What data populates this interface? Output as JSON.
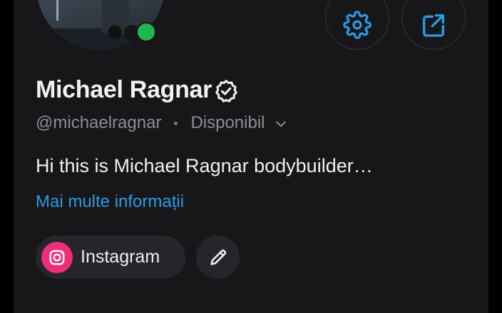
{
  "profile": {
    "name": "Michael Ragnar",
    "handle": "@michaelragnar",
    "status": "Disponibil",
    "bio": "Hi this is Michael Ragnar bodybuilder…",
    "more_info_label": "Mai multe informații",
    "online": true
  },
  "actions": {
    "settings_icon": "gear-icon",
    "share_icon": "share-icon"
  },
  "links": [
    {
      "label": "Instagram",
      "icon": "instagram-icon"
    }
  ],
  "colors": {
    "accent": "#2b9be6",
    "online": "#1fb84f",
    "instagram": "#ec2f7a",
    "background": "#17171a"
  }
}
